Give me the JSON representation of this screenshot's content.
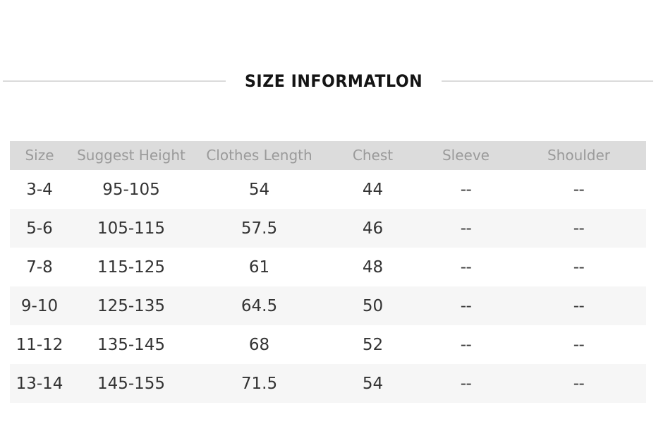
{
  "title": "SIZE INFORMATLON",
  "colors": {
    "title_text": "#141414",
    "rule": "#dbdbdb",
    "header_bg": "#dcdcdc",
    "header_text": "#9a9a9a",
    "row_bg": "#ffffff",
    "row_bg_alt": "#f6f6f6",
    "cell_text": "#333333"
  },
  "table": {
    "columns": [
      "Size",
      "Suggest Height",
      "Clothes Length",
      "Chest",
      "Sleeve",
      "Shoulder"
    ],
    "rows": [
      {
        "size": "3-4",
        "suggest_height": "95-105",
        "clothes_length": "54",
        "chest": "44",
        "sleeve": "--",
        "shoulder": "--"
      },
      {
        "size": "5-6",
        "suggest_height": "105-115",
        "clothes_length": "57.5",
        "chest": "46",
        "sleeve": "--",
        "shoulder": "--"
      },
      {
        "size": "7-8",
        "suggest_height": "115-125",
        "clothes_length": "61",
        "chest": "48",
        "sleeve": "--",
        "shoulder": "--"
      },
      {
        "size": "9-10",
        "suggest_height": "125-135",
        "clothes_length": "64.5",
        "chest": "50",
        "sleeve": "--",
        "shoulder": "--"
      },
      {
        "size": "11-12",
        "suggest_height": "135-145",
        "clothes_length": "68",
        "chest": "52",
        "sleeve": "--",
        "shoulder": "--"
      },
      {
        "size": "13-14",
        "suggest_height": "145-155",
        "clothes_length": "71.5",
        "chest": "54",
        "sleeve": "--",
        "shoulder": "--"
      }
    ]
  }
}
